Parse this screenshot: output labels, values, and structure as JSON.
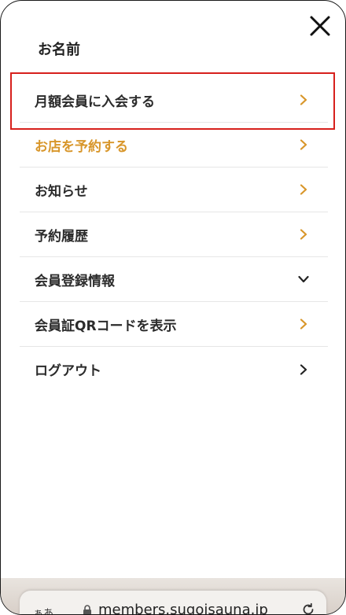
{
  "header": {
    "user_name": "お名前"
  },
  "menu": {
    "items": [
      {
        "label": "月額会員に入会する",
        "accent": false,
        "icon": "chevron-right-icon",
        "icon_color": "#d8962a"
      },
      {
        "label": "お店を予約する",
        "accent": true,
        "icon": "chevron-right-icon",
        "icon_color": "#d8962a"
      },
      {
        "label": "お知らせ",
        "accent": false,
        "icon": "chevron-right-icon",
        "icon_color": "#d8962a"
      },
      {
        "label": "予約履歴",
        "accent": false,
        "icon": "chevron-right-icon",
        "icon_color": "#d8962a"
      },
      {
        "label": "会員登録情報",
        "accent": false,
        "icon": "chevron-down-icon",
        "icon_color": "#222222"
      },
      {
        "label": "会員証QRコードを表示",
        "accent": false,
        "icon": "chevron-right-icon",
        "icon_color": "#d8962a"
      },
      {
        "label": "ログアウト",
        "accent": false,
        "icon": "chevron-right-icon",
        "icon_color": "#222222"
      }
    ]
  },
  "browser": {
    "text_size_label": "ぁあ",
    "url": "members.sugoisauna.jp"
  },
  "colors": {
    "accent": "#d8962a",
    "highlight": "#d7201c",
    "divider": "#e6e6e6"
  }
}
